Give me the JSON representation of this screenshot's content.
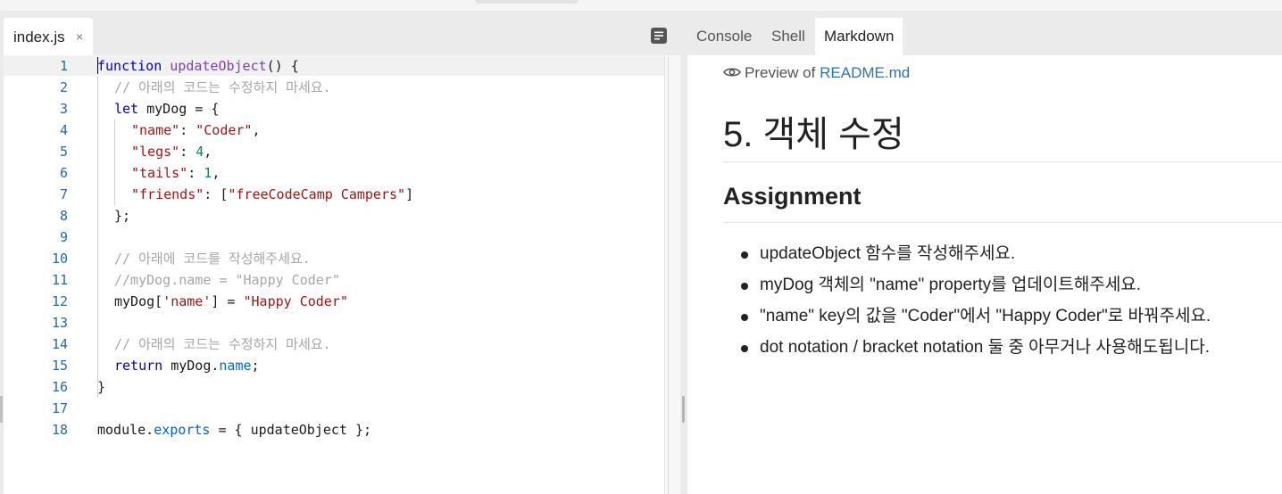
{
  "editor": {
    "tab_name": "index.js",
    "tab_close": "×",
    "format_icon": "format-document-icon",
    "line_numbers": [
      "1",
      "2",
      "3",
      "4",
      "5",
      "6",
      "7",
      "8",
      "9",
      "10",
      "11",
      "12",
      "13",
      "14",
      "15",
      "16",
      "17",
      "18"
    ]
  },
  "right": {
    "tabs": [
      "Console",
      "Shell",
      "Markdown"
    ],
    "active_tab": "Markdown",
    "preview_prefix": "Preview of",
    "preview_file": "README.md",
    "h1": "5. 객체 수정",
    "h2": "Assignment",
    "bullets": [
      "updateObject 함수를 작성해주세요.",
      "myDog 객체의 \"name\" property를 업데이트해주세요.",
      "\"name\" key의 값을 \"Coder\"에서 \"Happy Coder\"로 바꿔주세요.",
      "dot notation / bracket notation 둘 중 아무거나 사용해도됩니다."
    ]
  },
  "code": {
    "l1": [
      "function",
      " ",
      "updateObject",
      "() {"
    ],
    "l2": "// 아래의 코드는 수정하지 마세요.",
    "l3": [
      "let",
      " myDog = {"
    ],
    "l4": [
      "\"name\"",
      ": ",
      "\"Coder\"",
      ","
    ],
    "l5": [
      "\"legs\"",
      ": ",
      "4",
      ","
    ],
    "l6": [
      "\"tails\"",
      ": ",
      "1",
      ","
    ],
    "l7": [
      "\"friends\"",
      ": [",
      "\"freeCodeCamp Campers\"",
      "]"
    ],
    "l8": "};",
    "l10": "// 아래에 코드를 작성해주세요.",
    "l11": "//myDog.name = \"Happy Coder\"",
    "l12": [
      "myDog[",
      "'name'",
      "] = ",
      "\"Happy Coder\""
    ],
    "l14": "// 아래의 코드는 수정하지 마세요.",
    "l15": [
      "return",
      " myDog.",
      "name",
      ";"
    ],
    "l16": "}",
    "l18": [
      "module.",
      "exports",
      " = { updateObject };"
    ]
  }
}
